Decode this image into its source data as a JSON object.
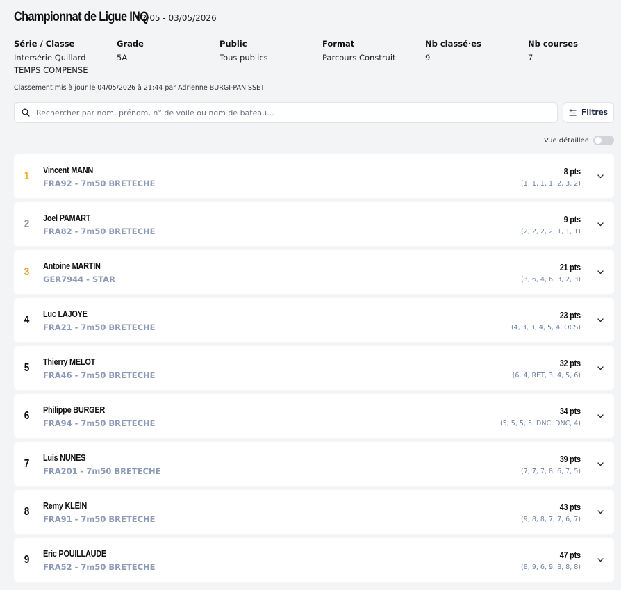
{
  "header": {
    "title": "Championnat de Ligue INQ",
    "dates": "02/05 - 03/05/2026"
  },
  "info": [
    {
      "label": "Série / Classe",
      "values": [
        "Intersérie Quillard",
        "TEMPS COMPENSE"
      ]
    },
    {
      "label": "Grade",
      "values": [
        "5A"
      ]
    },
    {
      "label": "Public",
      "values": [
        "Tous publics"
      ]
    },
    {
      "label": "Format",
      "values": [
        "Parcours Construit"
      ]
    },
    {
      "label": "Nb classé·es",
      "values": [
        "9"
      ]
    },
    {
      "label": "Nb courses",
      "values": [
        "7"
      ]
    }
  ],
  "updated": "Classement mis à jour le 04/05/2026 à 21:44 par Adrienne BURGI-PANISSET",
  "search": {
    "placeholder": "Rechercher par nom, prénom, n° de voile ou nom de bateau..."
  },
  "filters": {
    "label": "Filtres"
  },
  "detail_view": {
    "label": "Vue détaillée",
    "enabled": false
  },
  "colors": {
    "gold": "#f0b429",
    "silver": "#8a8f98",
    "bronze": "#e0a030",
    "default_rank": "#111111",
    "boat_text": "#8b9ab8"
  },
  "rankings": [
    {
      "rank": "1",
      "name": "Vincent MANN",
      "boat": "FRA92 - 7m50 BRETECHE",
      "points": "8 pts",
      "scores": "(1, 1, 1, 1, 2, 3, 2)",
      "rank_color": "#f0b429"
    },
    {
      "rank": "2",
      "name": "Joel PAMART",
      "boat": "FRA82 - 7m50 BRETECHE",
      "points": "9 pts",
      "scores": "(2, 2, 2, 2, 1, 1, 1)",
      "rank_color": "#8a8f98"
    },
    {
      "rank": "3",
      "name": "Antoine MARTIN",
      "boat": "GER7944 - STAR",
      "points": "21 pts",
      "scores": "(3, 6, 4, 6, 3, 2, 3)",
      "rank_color": "#e0a030"
    },
    {
      "rank": "4",
      "name": "Luc LAJOYE",
      "boat": "FRA21 - 7m50 BRETECHE",
      "points": "23 pts",
      "scores": "(4, 3, 3, 4, 5, 4, OCS)",
      "rank_color": "#111111"
    },
    {
      "rank": "5",
      "name": "Thierry MELOT",
      "boat": "FRA46 - 7m50 BRETECHE",
      "points": "32 pts",
      "scores": "(6, 4, RET, 3, 4, 5, 6)",
      "rank_color": "#111111"
    },
    {
      "rank": "6",
      "name": "Philippe BURGER",
      "boat": "FRA94 - 7m50 BRETECHE",
      "points": "34 pts",
      "scores": "(5, 5, 5, 5, DNC, DNC, 4)",
      "rank_color": "#111111"
    },
    {
      "rank": "7",
      "name": "Luis NUNES",
      "boat": "FRA201 - 7m50 BRETECHE",
      "points": "39 pts",
      "scores": "(7, 7, 7, 8, 6, 7, 5)",
      "rank_color": "#111111"
    },
    {
      "rank": "8",
      "name": "Remy KLEIN",
      "boat": "FRA91 - 7m50 BRETECHE",
      "points": "43 pts",
      "scores": "(9, 8, 8, 7, 7, 6, 7)",
      "rank_color": "#111111"
    },
    {
      "rank": "9",
      "name": "Eric POUILLAUDE",
      "boat": "FRA52 - 7m50 BRETECHE",
      "points": "47 pts",
      "scores": "(8, 9, 6, 9, 8, 8, 8)",
      "rank_color": "#111111"
    }
  ]
}
